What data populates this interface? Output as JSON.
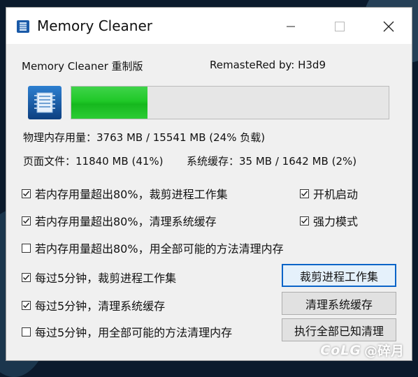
{
  "window": {
    "title": "Memory Cleaner",
    "icon": "memory-chip-icon"
  },
  "header": {
    "app_name": "Memory Cleaner 重制版",
    "credit": "RemasteRed by: H3d9"
  },
  "memory": {
    "usage_fraction": 0.24,
    "physical_line": "物理内存用量：3763 MB  /  15541 MB  (24% 负载)",
    "pagefile_line": "页面文件：11840 MB  (41%)",
    "syscache_line": "系统缓存：35 MB / 1642 MB  (2%)"
  },
  "options": [
    {
      "label": "若内存用量超出80%，裁剪进程工作集",
      "checked": true
    },
    {
      "label": "若内存用量超出80%，清理系统缓存",
      "checked": true
    },
    {
      "label": "若内存用量超出80%，用全部可能的方法清理内存",
      "checked": false
    },
    {
      "label": "每过5分钟，裁剪进程工作集",
      "checked": true
    },
    {
      "label": "每过5分钟，清理系统缓存",
      "checked": true
    },
    {
      "label": "每过5分钟，用全部可能的方法清理内存",
      "checked": false
    }
  ],
  "settings": [
    {
      "label": "开机启动",
      "checked": true
    },
    {
      "label": "强力模式",
      "checked": true
    }
  ],
  "buttons": {
    "trim": "裁剪进程工作集",
    "clear_cache": "清理系统缓存",
    "clean_all": "执行全部已知清理"
  },
  "watermark": {
    "logo": "CoLG",
    "author": "@碎月"
  },
  "colors": {
    "progress_fill": "#20c828",
    "default_button_border": "#0a64c8"
  }
}
